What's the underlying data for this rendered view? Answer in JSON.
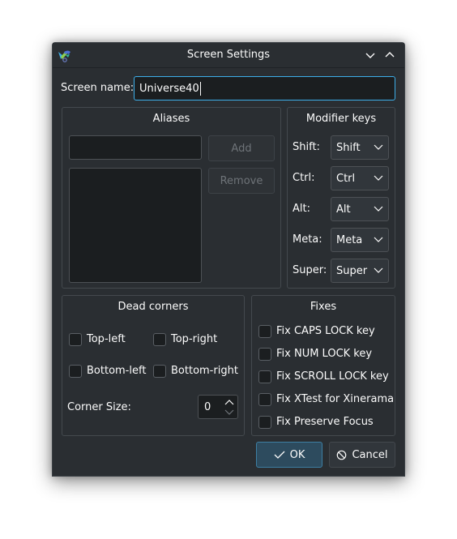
{
  "window": {
    "title": "Screen Settings",
    "icons": {
      "app": "barrier-app-icon",
      "minimize": "chevron-down-icon",
      "maximize": "chevron-up-icon"
    }
  },
  "screen_name": {
    "label": "Screen name:",
    "value": "Universe40"
  },
  "aliases": {
    "title": "Aliases",
    "input_value": "",
    "list_items": [],
    "add_label": "Add",
    "remove_label": "Remove"
  },
  "modifier_keys": {
    "title": "Modifier keys",
    "rows": [
      {
        "label": "Shift:",
        "value": "Shift"
      },
      {
        "label": "Ctrl:",
        "value": "Ctrl"
      },
      {
        "label": "Alt:",
        "value": "Alt"
      },
      {
        "label": "Meta:",
        "value": "Meta"
      },
      {
        "label": "Super:",
        "value": "Super"
      }
    ]
  },
  "dead_corners": {
    "title": "Dead corners",
    "corners": [
      {
        "label": "Top-left",
        "checked": false
      },
      {
        "label": "Top-right",
        "checked": false
      },
      {
        "label": "Bottom-left",
        "checked": false
      },
      {
        "label": "Bottom-right",
        "checked": false
      }
    ],
    "corner_size_label": "Corner Size:",
    "corner_size_value": "0"
  },
  "fixes": {
    "title": "Fixes",
    "items": [
      {
        "label": "Fix CAPS LOCK key",
        "checked": false
      },
      {
        "label": "Fix NUM LOCK key",
        "checked": false
      },
      {
        "label": "Fix SCROLL LOCK key",
        "checked": false
      },
      {
        "label": "Fix XTest for Xinerama",
        "checked": false
      },
      {
        "label": "Fix Preserve Focus",
        "checked": false
      }
    ]
  },
  "buttons": {
    "ok_label": "OK",
    "cancel_label": "Cancel"
  },
  "colors": {
    "accent": "#3daee9",
    "window_bg": "#2a2e32",
    "field_bg": "#1b1e20"
  }
}
